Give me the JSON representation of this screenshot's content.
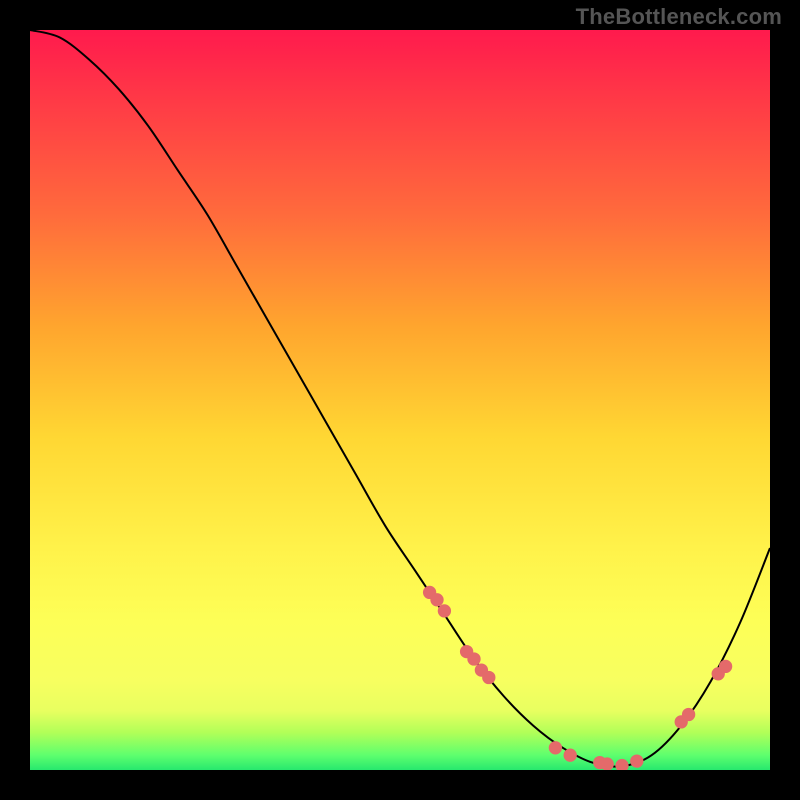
{
  "watermark": "TheBottleneck.com",
  "colors": {
    "curve": "#000000",
    "marker": "#e46a6a",
    "background_black": "#000000"
  },
  "chart_data": {
    "type": "line",
    "title": "",
    "xlabel": "",
    "ylabel": "",
    "xlim": [
      0,
      100
    ],
    "ylim": [
      0,
      100
    ],
    "grid": false,
    "series": [
      {
        "name": "bottleneck-curve",
        "x": [
          0,
          4,
          8,
          12,
          16,
          20,
          24,
          28,
          32,
          36,
          40,
          44,
          48,
          52,
          56,
          60,
          64,
          68,
          72,
          76,
          80,
          84,
          88,
          92,
          96,
          100
        ],
        "y": [
          100,
          99,
          96,
          92,
          87,
          81,
          75,
          68,
          61,
          54,
          47,
          40,
          33,
          27,
          21,
          15,
          10,
          6,
          3,
          1,
          0.5,
          2,
          6,
          12,
          20,
          30
        ]
      }
    ],
    "markers": {
      "name": "data-points",
      "x": [
        54,
        55,
        56,
        59,
        60,
        61,
        62,
        71,
        73,
        77,
        78,
        80,
        82,
        88,
        89,
        93,
        94
      ],
      "y": [
        24,
        23,
        21.5,
        16,
        15,
        13.5,
        12.5,
        3,
        2,
        1,
        0.8,
        0.6,
        1.2,
        6.5,
        7.5,
        13,
        14
      ]
    }
  }
}
